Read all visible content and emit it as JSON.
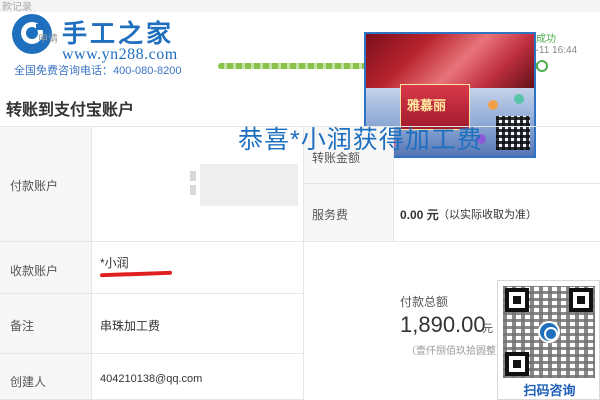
{
  "header": {
    "faded_left": "款记录",
    "faded_right": "",
    "logo_title": "手工之家",
    "logo_url": "www.yn288.com",
    "hotline": "全国免费咨询电话：400-080-8200",
    "faded_label1": "申请",
    "faded_label2": "",
    "status_success": "成功",
    "status_time": "7-11 16:44",
    "ad_brand": "雅慕丽"
  },
  "page": {
    "section_title": "转账到支付宝账户"
  },
  "form": {
    "payer_label": "付款账户",
    "payee_label": "收款账户",
    "payee_name": "*小润",
    "remark_label": "备注",
    "remark_value": "串珠加工费",
    "creator_label": "创建人",
    "creator_value": "404210138@qq.com",
    "amount_label": "转账金额",
    "amount_faded": "整)",
    "fee_label": "服务费",
    "fee_value": "0.00 元",
    "fee_note": "（以实际收取为准）",
    "total_label": "付款总额",
    "total_amount": "1,890.00",
    "total_unit": "元",
    "total_words": "（壹仟捌佰玖拾圆整）"
  },
  "overlay": {
    "caption": "恭喜*小润获得加工费"
  },
  "qr": {
    "button_label": "扫码咨询"
  }
}
